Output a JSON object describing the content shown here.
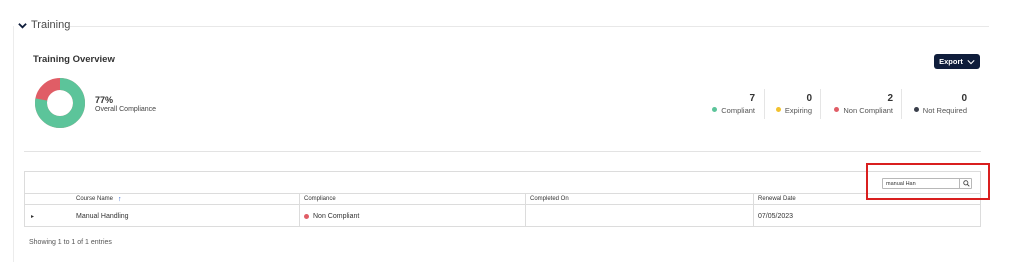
{
  "section": {
    "title": "Training",
    "icon": "chevron-down-icon"
  },
  "overview": {
    "title": "Training Overview",
    "export_label": "Export",
    "compliance_percent": "77%",
    "compliance_label": "Overall Compliance",
    "donut": {
      "compliant_fraction": 0.778,
      "colors": {
        "compliant": "#5cc49a",
        "non_compliant": "#e05d66"
      }
    }
  },
  "stats": [
    {
      "value": "7",
      "label": "Compliant",
      "color": "#5cc49a"
    },
    {
      "value": "0",
      "label": "Expiring",
      "color": "#f2c12e"
    },
    {
      "value": "2",
      "label": "Non Compliant",
      "color": "#e05d66"
    },
    {
      "value": "0",
      "label": "Not Required",
      "color": "#3a3f4b"
    }
  ],
  "table": {
    "search_value": "manual Han",
    "headers": [
      "",
      "Course Name",
      "Compliance",
      "Completed On",
      "Renewal Date"
    ],
    "sort_indicator": "↑",
    "rows": [
      {
        "expand": "▸",
        "course": "Manual Handling",
        "compliance": "Non Compliant",
        "compliance_color": "#e05d66",
        "completed_on": "",
        "renewal_date": "07/05/2023"
      }
    ],
    "info": "Showing 1 to 1 of 1 entries"
  }
}
